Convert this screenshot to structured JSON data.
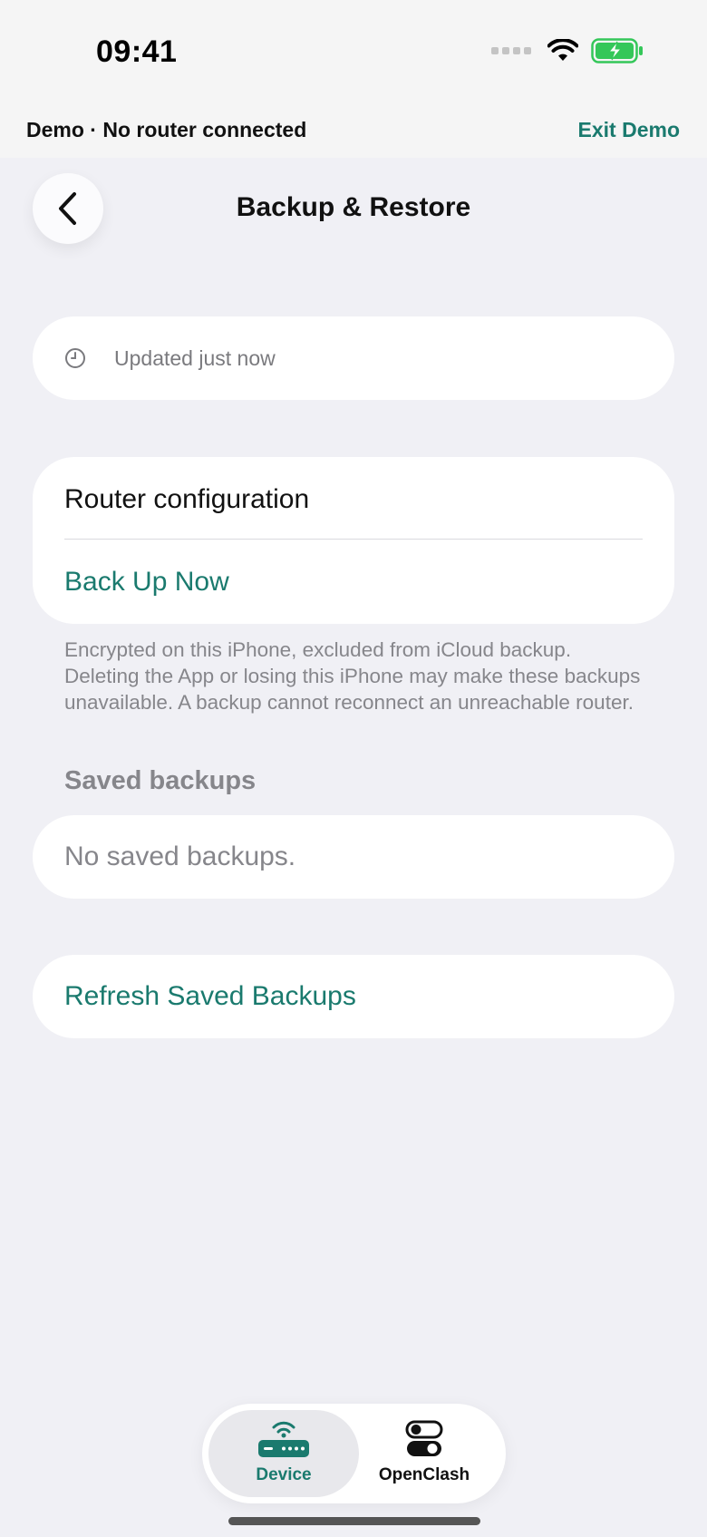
{
  "status_bar": {
    "time": "09:41",
    "icons": [
      "cellular-signal-icon",
      "wifi-icon",
      "battery-charging-icon"
    ]
  },
  "demo_banner": {
    "text": "Demo · No router connected",
    "exit_label": "Exit Demo"
  },
  "header": {
    "back_icon": "chevron-left-icon",
    "title": "Backup & Restore"
  },
  "updated": {
    "icon": "clock-icon",
    "text": "Updated just now"
  },
  "router_config": {
    "title": "Router configuration",
    "action_label": "Back Up Now"
  },
  "footnote": "Encrypted on this iPhone, excluded from iCloud backup. Deleting the App or losing this iPhone may make these backups unavailable. A backup cannot reconnect an unreachable router.",
  "saved_backups": {
    "header": "Saved backups",
    "empty_text": "No saved backups."
  },
  "refresh": {
    "label": "Refresh Saved Backups"
  },
  "tab_bar": {
    "tabs": [
      {
        "label": "Device",
        "icon": "router-icon",
        "selected": true
      },
      {
        "label": "OpenClash",
        "icon": "toggles-icon",
        "selected": false
      }
    ]
  },
  "colors": {
    "accent": "#1a7a6e",
    "background": "#f0f0f5",
    "battery": "#34c759"
  }
}
